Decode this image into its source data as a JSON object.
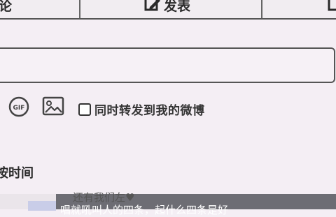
{
  "toolbar": {
    "left_label": "论",
    "post_label": "发表"
  },
  "actions": {
    "gif_label": "GIF",
    "repost_label": "同时转发到我的微博"
  },
  "section": {
    "title": "按时间"
  },
  "comment": {
    "top_text": "还有我们左♥",
    "body_text": "唱就吼叫人的四条，起什么四条是好"
  }
}
